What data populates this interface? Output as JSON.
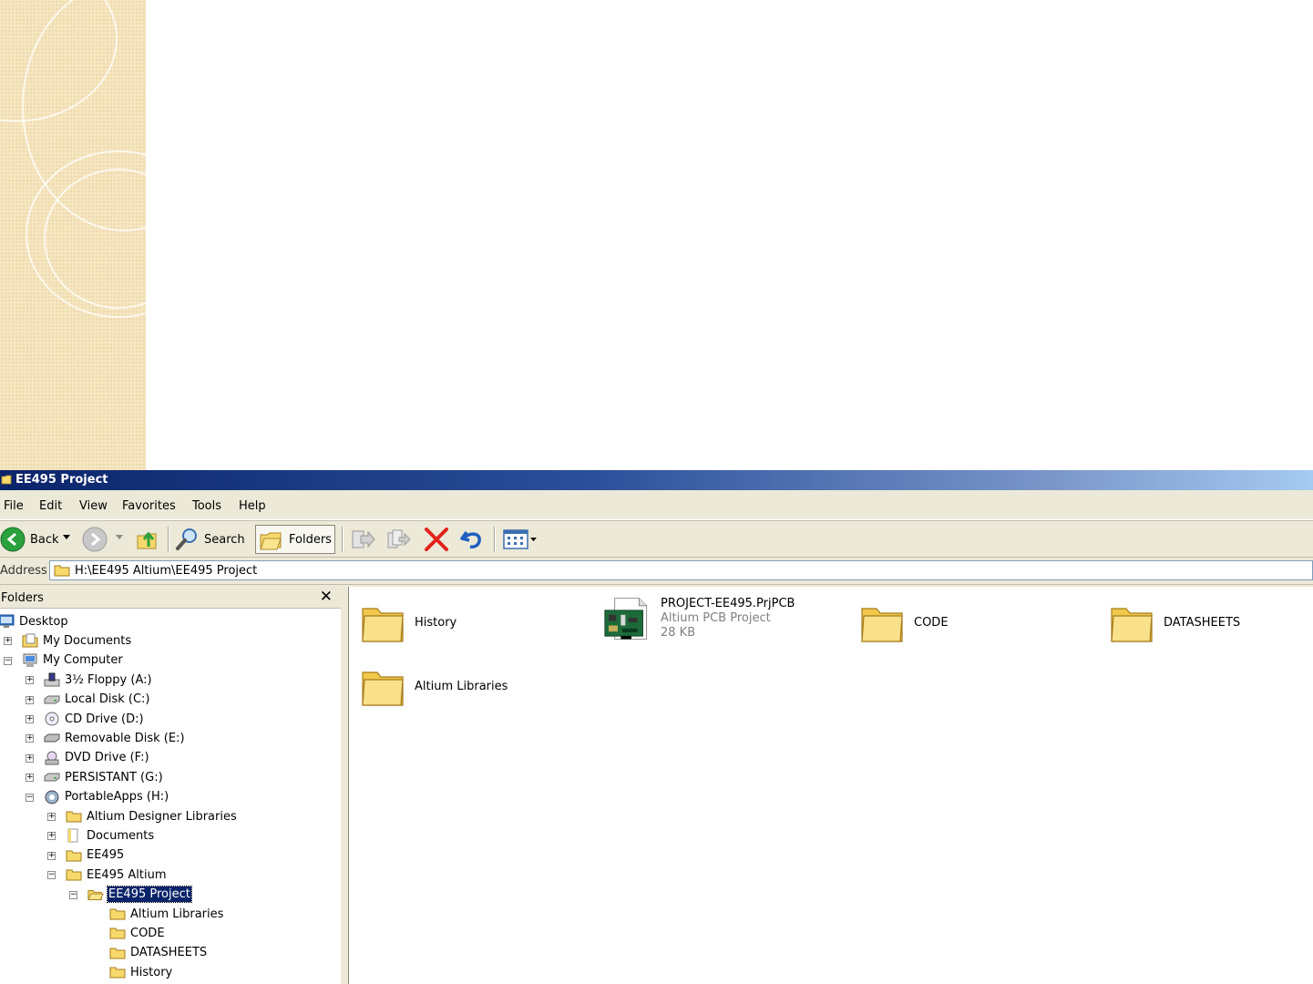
{
  "window": {
    "title": "EE495 Project"
  },
  "menu": [
    {
      "label": "File"
    },
    {
      "label": "Edit"
    },
    {
      "label": "View"
    },
    {
      "label": "Favorites"
    },
    {
      "label": "Tools"
    },
    {
      "label": "Help"
    }
  ],
  "toolbar": {
    "back_label": "Back",
    "search_label": "Search",
    "folders_label": "Folders"
  },
  "address": {
    "label": "Address",
    "value": "H:\\EE495 Altium\\EE495 Project"
  },
  "folder_pane": {
    "title": "Folders",
    "close_glyph": "✕",
    "tree": [
      {
        "label": "Desktop",
        "icon": "desktop-icon",
        "expander": ""
      },
      {
        "label": "My Documents",
        "icon": "my-documents-icon",
        "expander": "+"
      },
      {
        "label": "My Computer",
        "icon": "my-computer-icon",
        "expander": "−"
      },
      {
        "label": "3½ Floppy (A:)",
        "icon": "floppy-icon",
        "expander": "+"
      },
      {
        "label": "Local Disk (C:)",
        "icon": "hard-drive-icon",
        "expander": "+"
      },
      {
        "label": "CD Drive (D:)",
        "icon": "cd-drive-icon",
        "expander": "+"
      },
      {
        "label": "Removable Disk (E:)",
        "icon": "removable-disk-icon",
        "expander": "+"
      },
      {
        "label": "DVD Drive (F:)",
        "icon": "dvd-drive-icon",
        "expander": "+"
      },
      {
        "label": "PERSISTANT (G:)",
        "icon": "hard-drive-icon",
        "expander": "+"
      },
      {
        "label": "PortableApps (H:)",
        "icon": "portableapps-icon",
        "expander": "−"
      },
      {
        "label": "Altium Designer Libraries",
        "icon": "folder-icon",
        "expander": "+"
      },
      {
        "label": "Documents",
        "icon": "document-folder-icon",
        "expander": "+"
      },
      {
        "label": "EE495",
        "icon": "folder-icon",
        "expander": "+"
      },
      {
        "label": "EE495 Altium",
        "icon": "folder-icon",
        "expander": "−"
      },
      {
        "label": "EE495 Project",
        "icon": "folder-open-icon",
        "expander": "−"
      },
      {
        "label": "Altium Libraries",
        "icon": "folder-icon",
        "expander": ""
      },
      {
        "label": "CODE",
        "icon": "folder-icon",
        "expander": ""
      },
      {
        "label": "DATASHEETS",
        "icon": "folder-icon",
        "expander": ""
      },
      {
        "label": "History",
        "icon": "folder-icon",
        "expander": ""
      }
    ]
  },
  "content": {
    "items": [
      {
        "name": "History",
        "type": "",
        "size": "",
        "icon": "big-folder-icon"
      },
      {
        "name": "PROJECT-EE495.PrjPCB",
        "type": "Altium PCB Project",
        "size": "28 KB",
        "icon": "pcb-project-icon"
      },
      {
        "name": "CODE",
        "type": "",
        "size": "",
        "icon": "big-folder-icon"
      },
      {
        "name": "DATASHEETS",
        "type": "",
        "size": "",
        "icon": "big-folder-icon"
      },
      {
        "name": "Altium Libraries",
        "type": "",
        "size": "",
        "icon": "big-folder-icon"
      }
    ]
  },
  "colors": {
    "title_bar": "#0a246a",
    "window_face": "#ece9d8",
    "selection": "#0a246a",
    "folder_yellow": "#f6d86b",
    "delete_red": "#e2221b",
    "back_green": "#2aa13c"
  }
}
